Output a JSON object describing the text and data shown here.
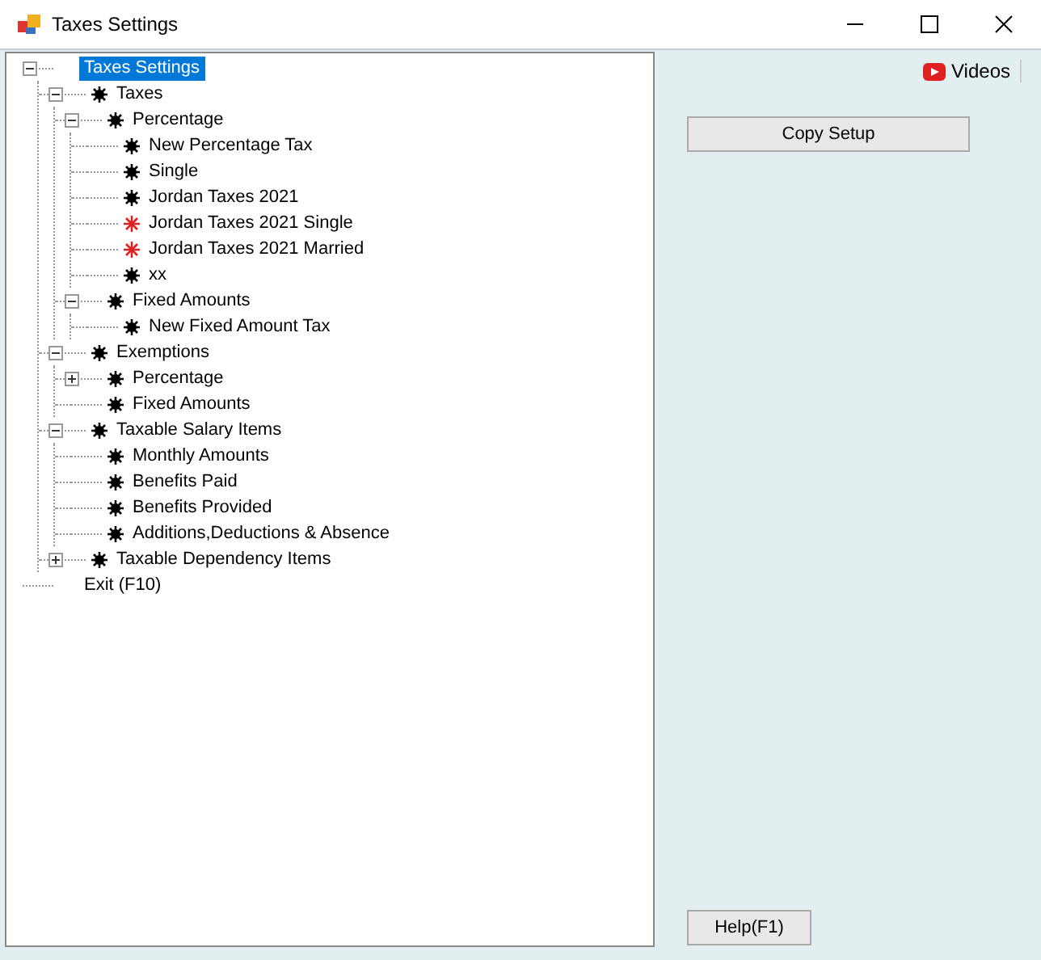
{
  "window": {
    "title": "Taxes Settings"
  },
  "tree": [
    {
      "label": "Taxes Settings",
      "kind": "plain",
      "selected": true,
      "expanded": true,
      "children": [
        {
          "label": "Taxes",
          "kind": "bullet",
          "selected": false,
          "expanded": true,
          "children": [
            {
              "label": "Percentage",
              "kind": "bullet",
              "selected": false,
              "expanded": true,
              "children": [
                {
                  "label": "New Percentage Tax",
                  "kind": "bullet",
                  "selected": false
                },
                {
                  "label": "Single",
                  "kind": "bullet",
                  "selected": false
                },
                {
                  "label": "Jordan Taxes 2021",
                  "kind": "bullet",
                  "selected": false
                },
                {
                  "label": "Jordan Taxes 2021 Single",
                  "kind": "star",
                  "selected": false
                },
                {
                  "label": "Jordan Taxes 2021 Married",
                  "kind": "star",
                  "selected": false
                },
                {
                  "label": "xx",
                  "kind": "bullet",
                  "selected": false
                }
              ]
            },
            {
              "label": "Fixed Amounts",
              "kind": "bullet",
              "selected": false,
              "expanded": true,
              "children": [
                {
                  "label": "New Fixed Amount Tax",
                  "kind": "bullet",
                  "selected": false
                }
              ]
            }
          ]
        },
        {
          "label": "Exemptions",
          "kind": "bullet",
          "selected": false,
          "expanded": true,
          "children": [
            {
              "label": "Percentage",
              "kind": "bullet",
              "selected": false,
              "expanded": false
            },
            {
              "label": "Fixed Amounts",
              "kind": "bullet",
              "selected": false
            }
          ]
        },
        {
          "label": "Taxable Salary Items",
          "kind": "bullet",
          "selected": false,
          "expanded": true,
          "children": [
            {
              "label": "Monthly Amounts",
              "kind": "bullet",
              "selected": false
            },
            {
              "label": "Benefits Paid",
              "kind": "bullet",
              "selected": false
            },
            {
              "label": "Benefits Provided",
              "kind": "bullet",
              "selected": false
            },
            {
              "label": "Additions,Deductions & Absence",
              "kind": "bullet",
              "selected": false
            }
          ]
        },
        {
          "label": "Taxable Dependency Items",
          "kind": "bullet",
          "selected": false,
          "expanded": false
        }
      ]
    },
    {
      "label": "Exit (F10)",
      "kind": "plain",
      "selected": false
    }
  ],
  "videos_link": "Videos",
  "buttons": [
    {
      "label": "Copy Setup",
      "kind": "top"
    },
    {
      "label": "Help(F1)",
      "kind": "bottom"
    }
  ]
}
